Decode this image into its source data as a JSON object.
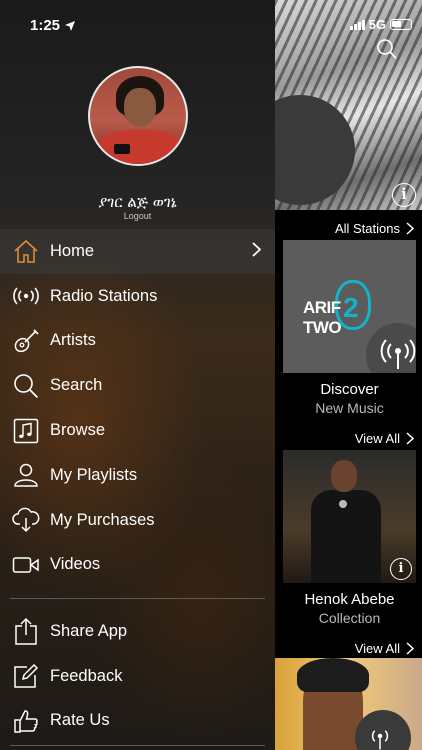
{
  "status": {
    "time": "1:25",
    "network": "5G"
  },
  "user": {
    "name": "ያገር ልጅ ወገኔ",
    "logout_label": "Logout"
  },
  "menu": {
    "items": [
      {
        "label": "Home",
        "icon": "home-icon",
        "active": true
      },
      {
        "label": "Radio Stations",
        "icon": "radio-broadcast-icon"
      },
      {
        "label": "Artists",
        "icon": "guitar-icon"
      },
      {
        "label": "Search",
        "icon": "search-icon"
      },
      {
        "label": "Browse",
        "icon": "music-note-icon"
      },
      {
        "label": "My Playlists",
        "icon": "person-icon"
      },
      {
        "label": "My Purchases",
        "icon": "cloud-download-icon"
      },
      {
        "label": "Videos",
        "icon": "video-camera-icon"
      }
    ],
    "secondary": [
      {
        "label": "Share App",
        "icon": "share-icon"
      },
      {
        "label": "Feedback",
        "icon": "edit-icon"
      },
      {
        "label": "Rate Us",
        "icon": "thumbs-up-icon"
      }
    ]
  },
  "content": {
    "all_stations_label": "All Stations",
    "tiles": [
      {
        "image_text_left": "ARIF",
        "image_text_mid": "2",
        "image_text_right": "TWO",
        "title": "Discover",
        "subtitle": "New Music",
        "link": "View All"
      },
      {
        "title": "Henok Abebe",
        "subtitle": "Collection",
        "link": "View All"
      }
    ]
  },
  "colors": {
    "accent": "#e3893a",
    "drawer_bg": "#242424",
    "tile_teal": "#14b3c9"
  }
}
